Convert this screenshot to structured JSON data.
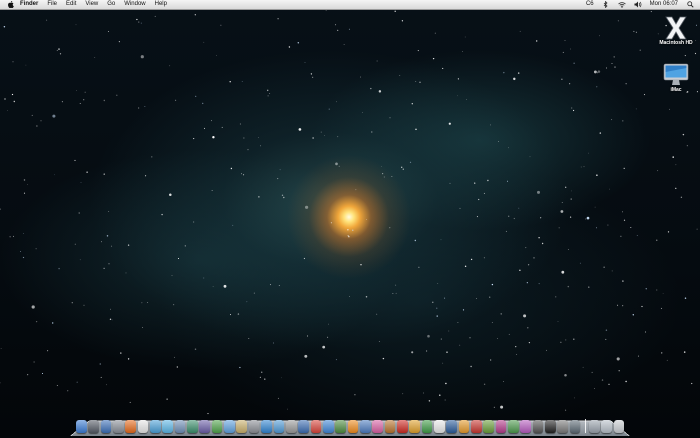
{
  "menubar": {
    "apple_icon": "apple-icon",
    "items": [
      "Finder",
      "File",
      "Edit",
      "View",
      "Go",
      "Window",
      "Help"
    ],
    "status": {
      "battery_text": "C6",
      "clock": "Mon 06:07",
      "icons": [
        "bluetooth-icon",
        "wifi-icon",
        "volume-icon",
        "spotlight-icon"
      ]
    }
  },
  "desktop": {
    "icons": [
      {
        "label": "Macintosh HD",
        "icon": "x-drive-icon"
      },
      {
        "label": "iMac",
        "icon": "imac-icon"
      }
    ]
  },
  "dock": {
    "apps": [
      {
        "icon": "finder-icon",
        "color": "#3a7bd5"
      },
      {
        "icon": "dashboard-icon",
        "color": "#555b66"
      },
      {
        "icon": "mission-control-icon",
        "color": "#3b6fb8"
      },
      {
        "icon": "launchpad-icon",
        "color": "#8a8f98"
      },
      {
        "icon": "firefox-icon",
        "color": "#e66a1c"
      },
      {
        "icon": "calendar-icon",
        "color": "#e8e8e8"
      },
      {
        "icon": "contacts-icon",
        "color": "#4aa0d8"
      },
      {
        "icon": "ichat-icon",
        "color": "#5bb6e6"
      },
      {
        "icon": "mail-icon",
        "color": "#6f8fb7"
      },
      {
        "icon": "network-icon",
        "color": "#3a8f6b"
      },
      {
        "icon": "pen-icon",
        "color": "#6b5ea8"
      },
      {
        "icon": "leaf-icon",
        "color": "#4fa34a"
      },
      {
        "icon": "itunes-icon",
        "color": "#5fa2e0"
      },
      {
        "icon": "photo-icon",
        "color": "#c9b06b"
      },
      {
        "icon": "system-preferences-icon",
        "color": "#8c8f96"
      },
      {
        "icon": "safari-icon",
        "color": "#2f84d1"
      },
      {
        "icon": "preview-icon",
        "color": "#4f9ad6"
      },
      {
        "icon": "tools-icon",
        "color": "#9a9a9a"
      },
      {
        "icon": "xcode-icon",
        "color": "#3c6db3"
      },
      {
        "icon": "game-icon",
        "color": "#d8443a"
      },
      {
        "icon": "quicktime-icon",
        "color": "#3f86d6"
      },
      {
        "icon": "chart-icon",
        "color": "#4d8c3f"
      },
      {
        "icon": "vlc-icon",
        "color": "#ef8b1c"
      },
      {
        "icon": "keynote-icon",
        "color": "#4c7cc0"
      },
      {
        "icon": "gamecenter-icon",
        "color": "#d95fa3"
      },
      {
        "icon": "guitar-icon",
        "color": "#b9742e"
      },
      {
        "icon": "acrobat-icon",
        "color": "#cf2a22"
      },
      {
        "icon": "pages-icon",
        "color": "#e0a12b"
      },
      {
        "icon": "numbers-icon",
        "color": "#3f9b46"
      },
      {
        "icon": "textedit-icon",
        "color": "#e9e9e9"
      },
      {
        "icon": "photoshop-icon",
        "color": "#2b5c9b"
      },
      {
        "icon": "illustrator-icon",
        "color": "#e59a2b"
      },
      {
        "icon": "flash-icon",
        "color": "#c8362f"
      },
      {
        "icon": "bridge-icon",
        "color": "#6a9f3a"
      },
      {
        "icon": "indesign-icon",
        "color": "#b43b8a"
      },
      {
        "icon": "dreamweaver-icon",
        "color": "#4c9a4c"
      },
      {
        "icon": "wand-icon",
        "color": "#b65bbf"
      },
      {
        "icon": "camera-icon",
        "color": "#555555"
      },
      {
        "icon": "terminal-icon",
        "color": "#222222"
      },
      {
        "icon": "console-icon",
        "color": "#7a7a7a"
      },
      {
        "icon": "activity-monitor-icon",
        "color": "#5c6a75"
      },
      {
        "icon": "applications-folder-icon",
        "color": "#9aa3ad"
      },
      {
        "icon": "documents-folder-icon",
        "color": "#b8c0c9"
      },
      {
        "icon": "trash-icon",
        "color": "#c9cdd2"
      }
    ]
  }
}
